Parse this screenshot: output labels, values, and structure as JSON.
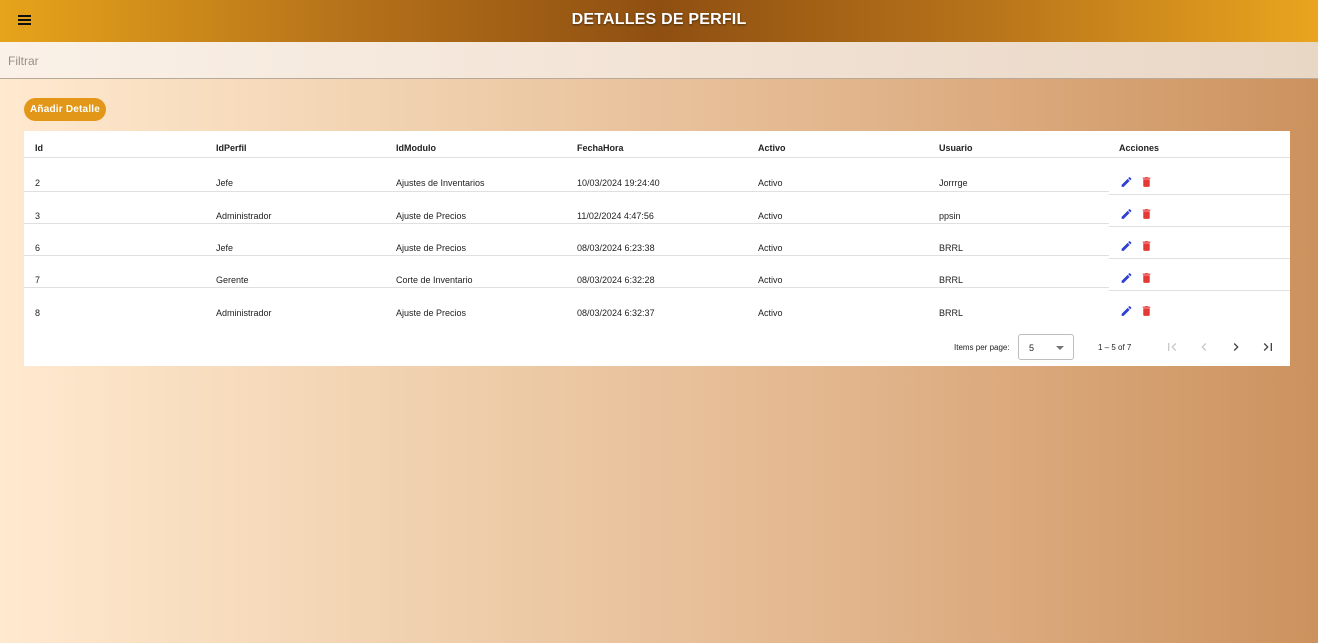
{
  "header": {
    "title": "DETALLES DE PERFIL",
    "menu_icon": "menu-icon"
  },
  "filter": {
    "placeholder": "Filtrar",
    "value": ""
  },
  "actions": {
    "add_label": "Añadir Detalle"
  },
  "table": {
    "columns": [
      "Id",
      "IdPerfil",
      "IdModulo",
      "FechaHora",
      "Activo",
      "Usuario",
      "Acciones"
    ],
    "rows": [
      [
        "2",
        "Jefe",
        "Ajustes de Inventarios",
        "10/03/2024 19:24:40",
        "Activo",
        "Jorrrge"
      ],
      [
        "3",
        "Administrador",
        "Ajuste de Precios",
        "11/02/2024 4:47:56",
        "Activo",
        "ppsin"
      ],
      [
        "6",
        "Jefe",
        "Ajuste de Precios",
        "08/03/2024 6:23:38",
        "Activo",
        "BRRL"
      ],
      [
        "7",
        "Gerente",
        "Corte de Inventario",
        "08/03/2024 6:32:28",
        "Activo",
        "BRRL"
      ],
      [
        "8",
        "Administrador",
        "Ajuste de Precios",
        "08/03/2024 6:32:37",
        "Activo",
        "BRRL"
      ]
    ],
    "row_actions": [
      "edit-icon",
      "delete-icon"
    ]
  },
  "paginator": {
    "items_per_page_label": "Items per page:",
    "page_size": "5",
    "range_label": "1 – 5 of 7"
  },
  "colors": {
    "accent": "#e29719",
    "edit": "#2f3fd6",
    "delete": "#e53935"
  }
}
